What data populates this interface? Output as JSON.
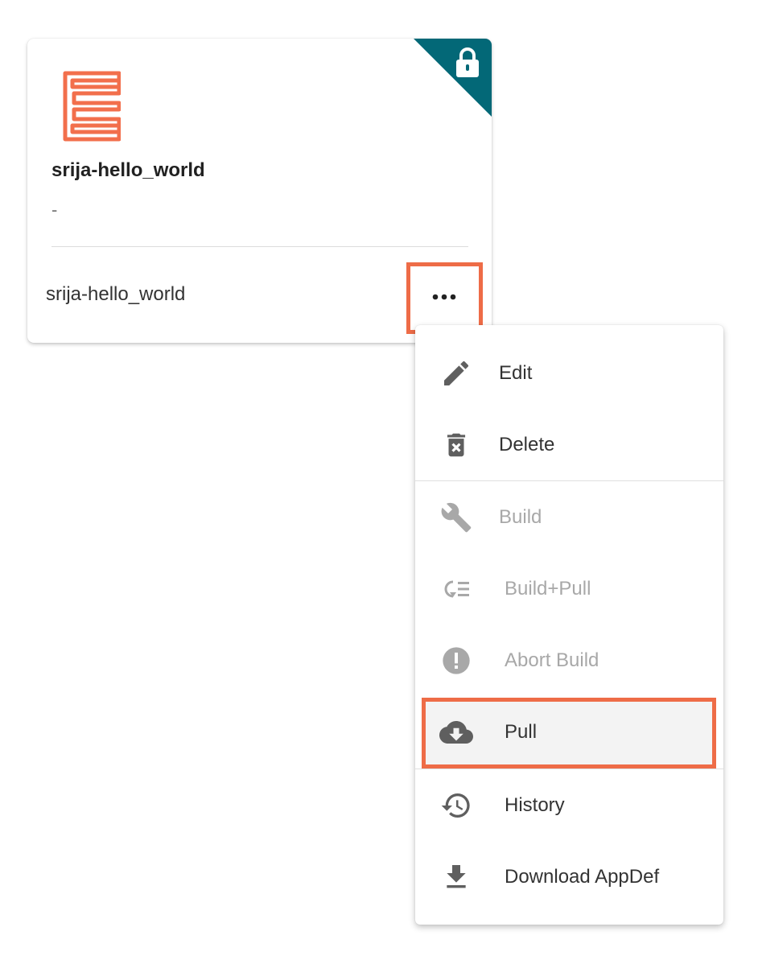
{
  "card": {
    "title": "srija-hello_world",
    "description": "-",
    "subtitle": "srija-hello_world",
    "logo_icon": "app-logo-icon",
    "lock_icon": "lock-icon",
    "more_icon": "more-horizontal-icon"
  },
  "menu": {
    "items": [
      {
        "label": "Edit",
        "icon": "pencil-icon",
        "disabled": false
      },
      {
        "label": "Delete",
        "icon": "trash-icon",
        "disabled": false
      },
      {
        "label": "Build",
        "icon": "wrench-icon",
        "disabled": true
      },
      {
        "label": "Build+Pull",
        "icon": "build-pull-icon",
        "disabled": true
      },
      {
        "label": "Abort Build",
        "icon": "alert-circle-icon",
        "disabled": true
      },
      {
        "label": "Pull",
        "icon": "cloud-download-icon",
        "disabled": false,
        "highlighted": true
      },
      {
        "label": "History",
        "icon": "history-icon",
        "disabled": false
      },
      {
        "label": "Download AppDef",
        "icon": "download-icon",
        "disabled": false
      }
    ]
  },
  "colors": {
    "accent": "#ee6c47",
    "ribbon": "#036877",
    "logo": "#f26f4c"
  }
}
